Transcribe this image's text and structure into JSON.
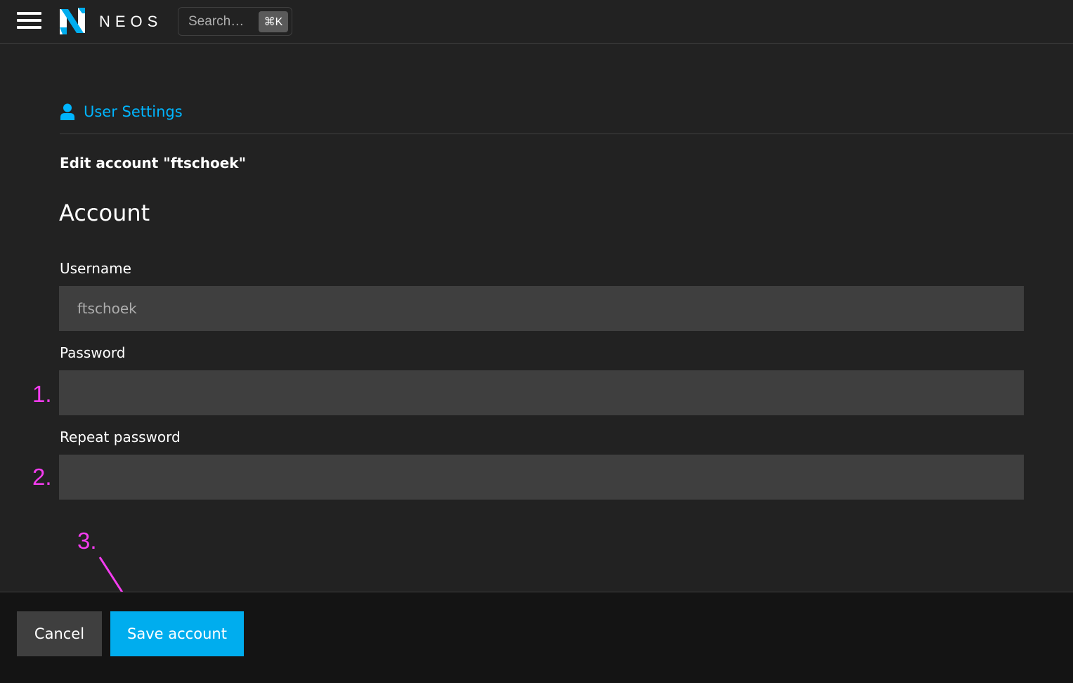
{
  "topbar": {
    "brand": "NEOS",
    "search": {
      "placeholder": "Search…",
      "shortcut": "⌘K"
    }
  },
  "module": {
    "title": "User Settings",
    "icon": "user-icon"
  },
  "form": {
    "heading": "Edit account \"ftschoek\"",
    "section": "Account",
    "fields": [
      {
        "label": "Username",
        "value": "ftschoek",
        "disabled": true
      },
      {
        "label": "Password",
        "value": ""
      },
      {
        "label": "Repeat password",
        "value": ""
      }
    ]
  },
  "annotations": [
    "1.",
    "2.",
    "3."
  ],
  "footer": {
    "cancel_label": "Cancel",
    "save_label": "Save account"
  },
  "colors": {
    "accent": "#00adee",
    "link": "#00b5ff",
    "annotation": "#f43cf0",
    "background": "#222222",
    "input_bg": "#3f3f3f"
  }
}
